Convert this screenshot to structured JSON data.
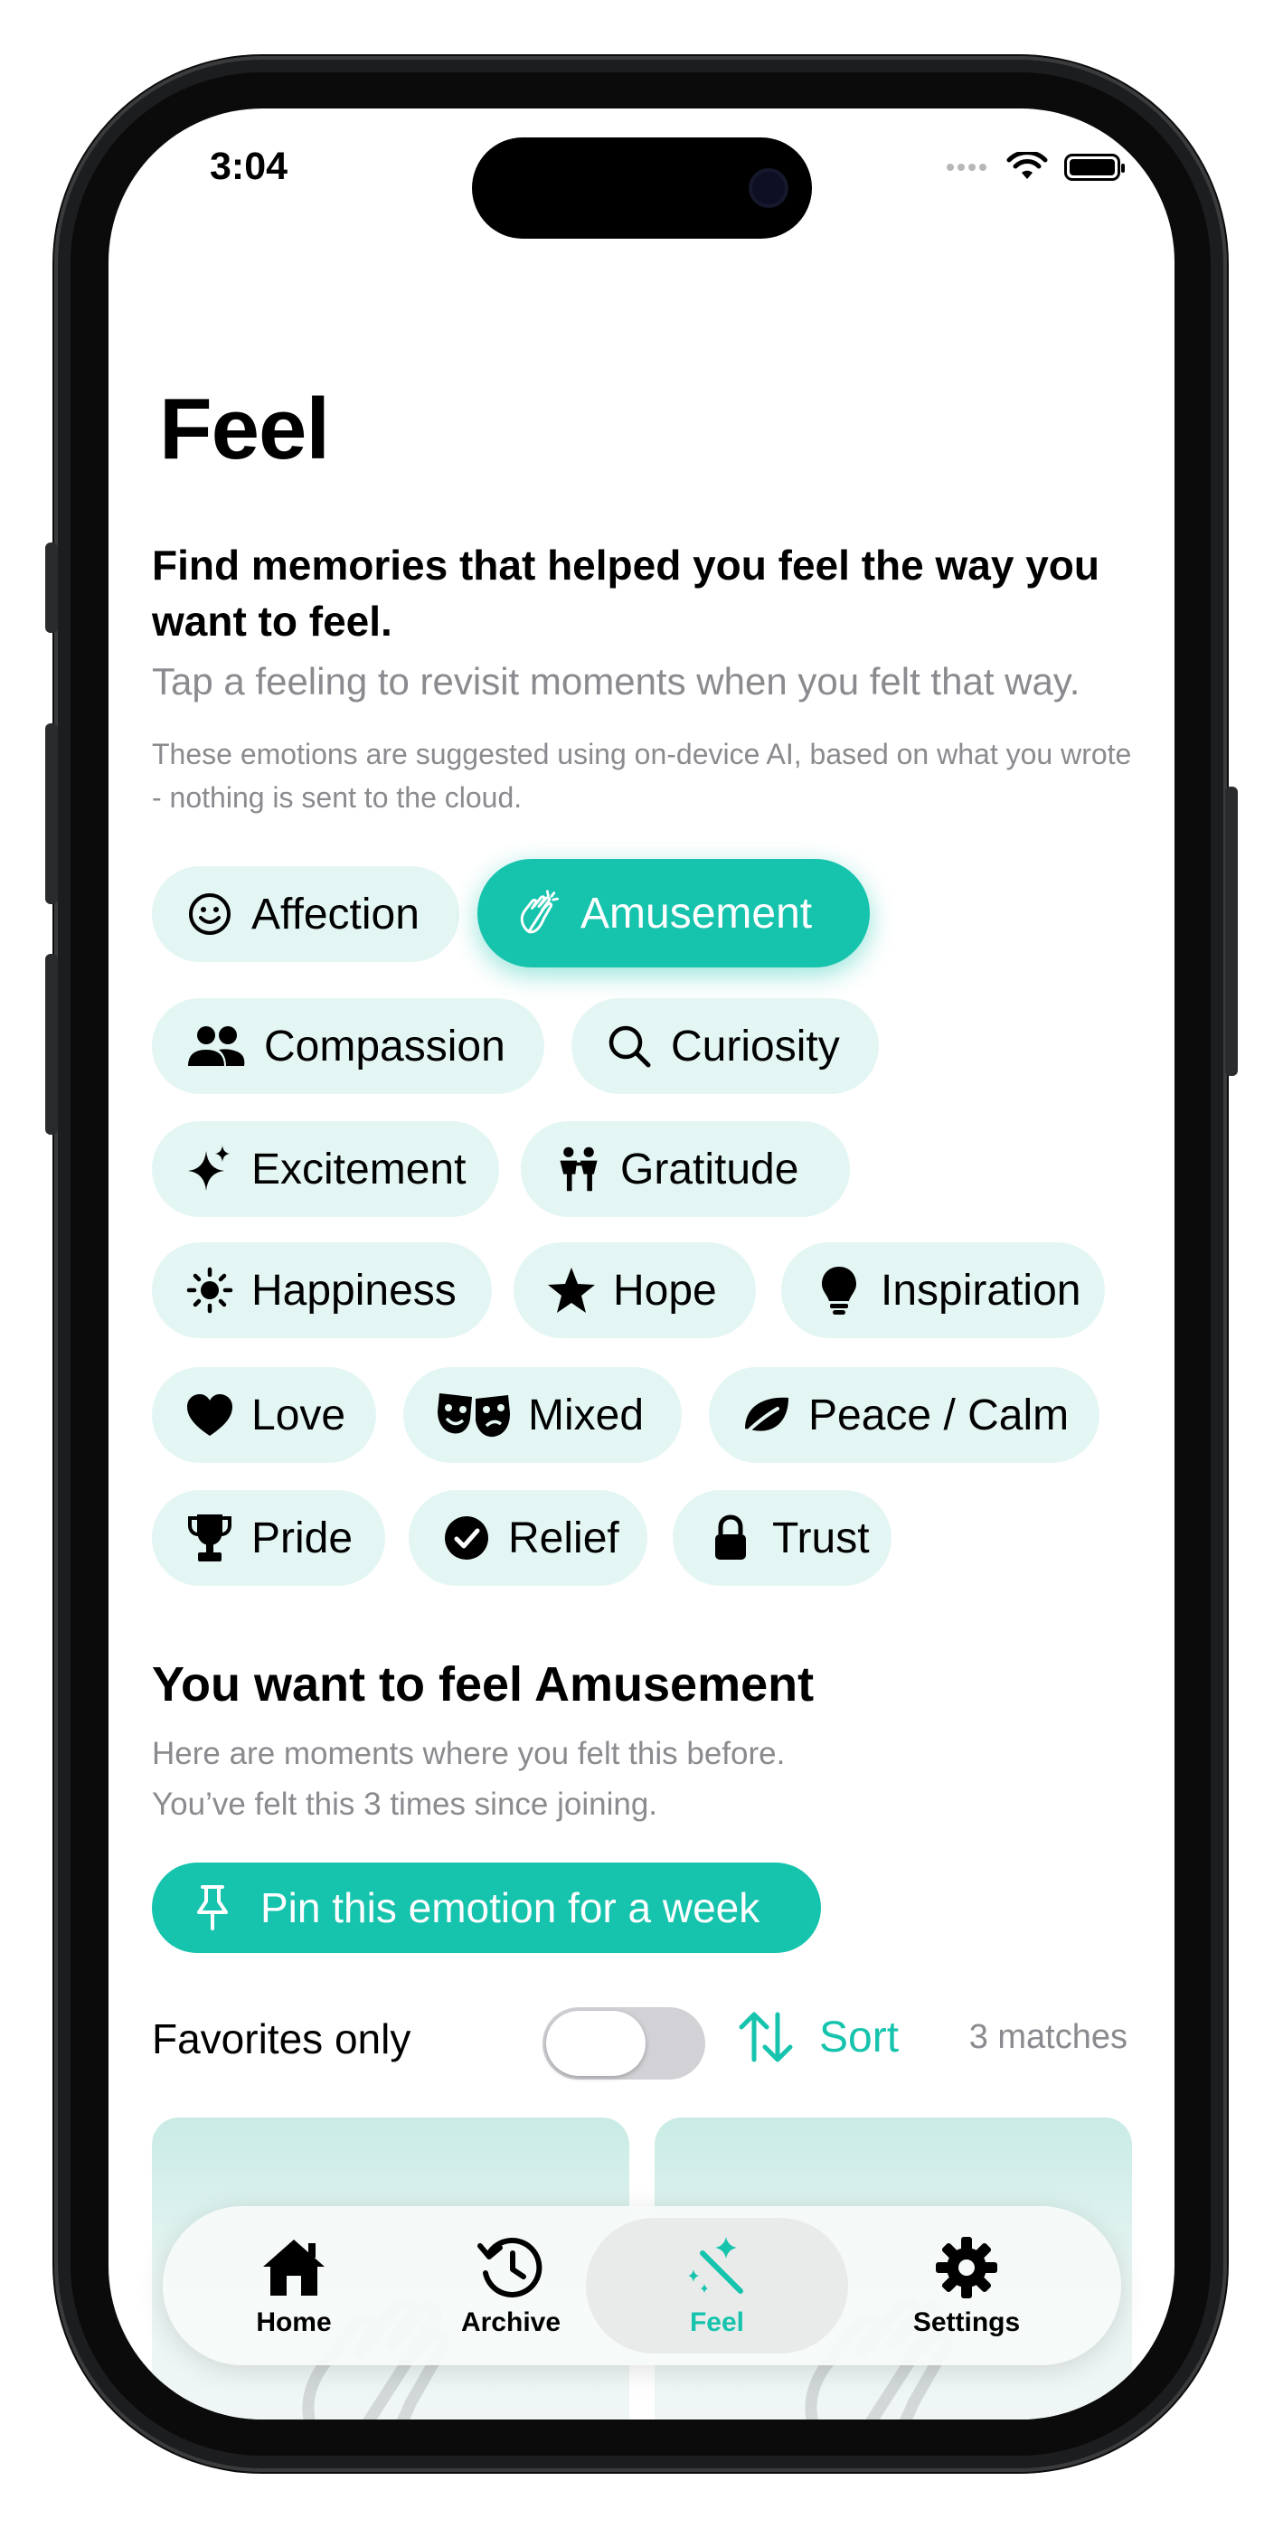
{
  "status_bar": {
    "time": "3:04"
  },
  "page": {
    "title": "Feel",
    "heading": "Find memories that helped you feel the way you want to feel.",
    "subtitle": "Tap a feeling to revisit moments when you felt that way.",
    "note": "These emotions are suggested using on-device AI, based on what you wrote - nothing is sent to the cloud."
  },
  "emotions": [
    {
      "label": "Affection",
      "icon": "smile-icon"
    },
    {
      "label": "Amusement",
      "icon": "clapping-hands-icon",
      "selected": true
    },
    {
      "label": "Compassion",
      "icon": "people-icon"
    },
    {
      "label": "Curiosity",
      "icon": "magnifier-icon"
    },
    {
      "label": "Excitement",
      "icon": "sparkles-icon"
    },
    {
      "label": "Gratitude",
      "icon": "two-people-icon"
    },
    {
      "label": "Happiness",
      "icon": "sun-icon"
    },
    {
      "label": "Hope",
      "icon": "star-icon"
    },
    {
      "label": "Inspiration",
      "icon": "lightbulb-icon"
    },
    {
      "label": "Love",
      "icon": "heart-icon"
    },
    {
      "label": "Mixed",
      "icon": "theater-masks-icon"
    },
    {
      "label": "Peace / Calm",
      "icon": "leaf-icon"
    },
    {
      "label": "Pride",
      "icon": "trophy-icon"
    },
    {
      "label": "Relief",
      "icon": "checkmark-circle-icon"
    },
    {
      "label": "Trust",
      "icon": "lock-icon"
    }
  ],
  "selection": {
    "title": "You want to feel Amusement",
    "line1": "Here are moments where you felt this before.",
    "line2": "You’ve felt this 3 times since joining.",
    "pin_label": "Pin this emotion for a week"
  },
  "filters": {
    "favorites_label": "Favorites only",
    "favorites_on": false,
    "sort_label": "Sort",
    "matches": "3 matches"
  },
  "tabs": [
    {
      "label": "Home",
      "icon": "house-icon"
    },
    {
      "label": "Archive",
      "icon": "history-icon"
    },
    {
      "label": "Feel",
      "icon": "magic-wand-icon",
      "active": true
    },
    {
      "label": "Settings",
      "icon": "gear-icon"
    }
  ],
  "colors": {
    "accent": "#16c3ad",
    "chip_bg": "#e4f6f3",
    "secondary_text": "#8a8a8f"
  }
}
